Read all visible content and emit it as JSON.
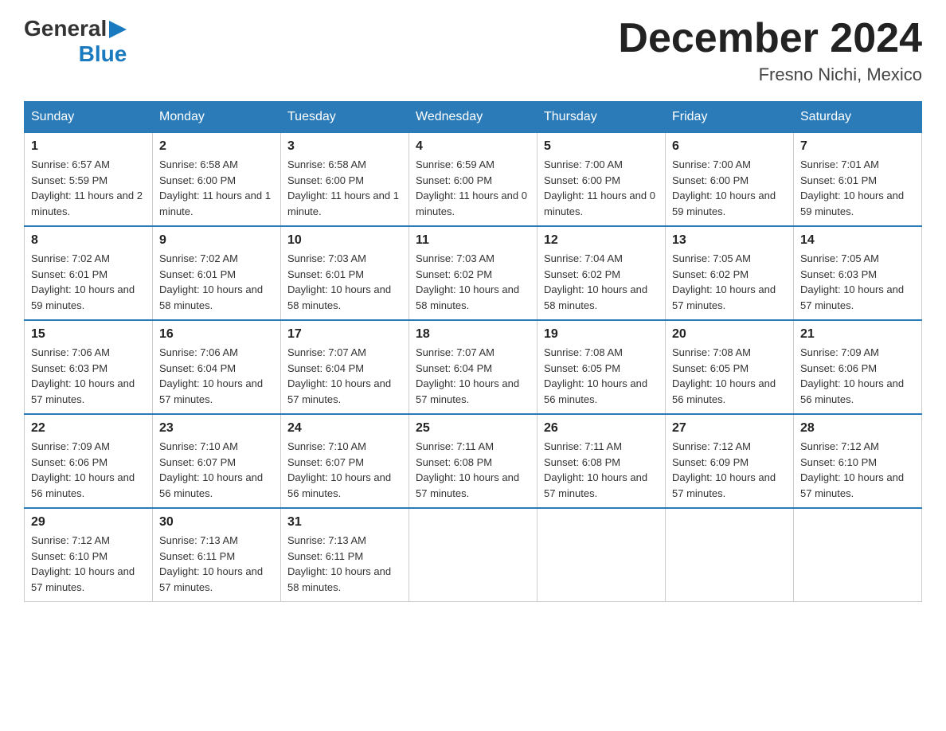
{
  "header": {
    "logo": {
      "general": "General",
      "arrow": "▶",
      "blue": "Blue"
    },
    "title": "December 2024",
    "location": "Fresno Nichi, Mexico"
  },
  "days_of_week": [
    "Sunday",
    "Monday",
    "Tuesday",
    "Wednesday",
    "Thursday",
    "Friday",
    "Saturday"
  ],
  "weeks": [
    [
      {
        "day": "1",
        "sunrise": "Sunrise: 6:57 AM",
        "sunset": "Sunset: 5:59 PM",
        "daylight": "Daylight: 11 hours and 2 minutes."
      },
      {
        "day": "2",
        "sunrise": "Sunrise: 6:58 AM",
        "sunset": "Sunset: 6:00 PM",
        "daylight": "Daylight: 11 hours and 1 minute."
      },
      {
        "day": "3",
        "sunrise": "Sunrise: 6:58 AM",
        "sunset": "Sunset: 6:00 PM",
        "daylight": "Daylight: 11 hours and 1 minute."
      },
      {
        "day": "4",
        "sunrise": "Sunrise: 6:59 AM",
        "sunset": "Sunset: 6:00 PM",
        "daylight": "Daylight: 11 hours and 0 minutes."
      },
      {
        "day": "5",
        "sunrise": "Sunrise: 7:00 AM",
        "sunset": "Sunset: 6:00 PM",
        "daylight": "Daylight: 11 hours and 0 minutes."
      },
      {
        "day": "6",
        "sunrise": "Sunrise: 7:00 AM",
        "sunset": "Sunset: 6:00 PM",
        "daylight": "Daylight: 10 hours and 59 minutes."
      },
      {
        "day": "7",
        "sunrise": "Sunrise: 7:01 AM",
        "sunset": "Sunset: 6:01 PM",
        "daylight": "Daylight: 10 hours and 59 minutes."
      }
    ],
    [
      {
        "day": "8",
        "sunrise": "Sunrise: 7:02 AM",
        "sunset": "Sunset: 6:01 PM",
        "daylight": "Daylight: 10 hours and 59 minutes."
      },
      {
        "day": "9",
        "sunrise": "Sunrise: 7:02 AM",
        "sunset": "Sunset: 6:01 PM",
        "daylight": "Daylight: 10 hours and 58 minutes."
      },
      {
        "day": "10",
        "sunrise": "Sunrise: 7:03 AM",
        "sunset": "Sunset: 6:01 PM",
        "daylight": "Daylight: 10 hours and 58 minutes."
      },
      {
        "day": "11",
        "sunrise": "Sunrise: 7:03 AM",
        "sunset": "Sunset: 6:02 PM",
        "daylight": "Daylight: 10 hours and 58 minutes."
      },
      {
        "day": "12",
        "sunrise": "Sunrise: 7:04 AM",
        "sunset": "Sunset: 6:02 PM",
        "daylight": "Daylight: 10 hours and 58 minutes."
      },
      {
        "day": "13",
        "sunrise": "Sunrise: 7:05 AM",
        "sunset": "Sunset: 6:02 PM",
        "daylight": "Daylight: 10 hours and 57 minutes."
      },
      {
        "day": "14",
        "sunrise": "Sunrise: 7:05 AM",
        "sunset": "Sunset: 6:03 PM",
        "daylight": "Daylight: 10 hours and 57 minutes."
      }
    ],
    [
      {
        "day": "15",
        "sunrise": "Sunrise: 7:06 AM",
        "sunset": "Sunset: 6:03 PM",
        "daylight": "Daylight: 10 hours and 57 minutes."
      },
      {
        "day": "16",
        "sunrise": "Sunrise: 7:06 AM",
        "sunset": "Sunset: 6:04 PM",
        "daylight": "Daylight: 10 hours and 57 minutes."
      },
      {
        "day": "17",
        "sunrise": "Sunrise: 7:07 AM",
        "sunset": "Sunset: 6:04 PM",
        "daylight": "Daylight: 10 hours and 57 minutes."
      },
      {
        "day": "18",
        "sunrise": "Sunrise: 7:07 AM",
        "sunset": "Sunset: 6:04 PM",
        "daylight": "Daylight: 10 hours and 57 minutes."
      },
      {
        "day": "19",
        "sunrise": "Sunrise: 7:08 AM",
        "sunset": "Sunset: 6:05 PM",
        "daylight": "Daylight: 10 hours and 56 minutes."
      },
      {
        "day": "20",
        "sunrise": "Sunrise: 7:08 AM",
        "sunset": "Sunset: 6:05 PM",
        "daylight": "Daylight: 10 hours and 56 minutes."
      },
      {
        "day": "21",
        "sunrise": "Sunrise: 7:09 AM",
        "sunset": "Sunset: 6:06 PM",
        "daylight": "Daylight: 10 hours and 56 minutes."
      }
    ],
    [
      {
        "day": "22",
        "sunrise": "Sunrise: 7:09 AM",
        "sunset": "Sunset: 6:06 PM",
        "daylight": "Daylight: 10 hours and 56 minutes."
      },
      {
        "day": "23",
        "sunrise": "Sunrise: 7:10 AM",
        "sunset": "Sunset: 6:07 PM",
        "daylight": "Daylight: 10 hours and 56 minutes."
      },
      {
        "day": "24",
        "sunrise": "Sunrise: 7:10 AM",
        "sunset": "Sunset: 6:07 PM",
        "daylight": "Daylight: 10 hours and 56 minutes."
      },
      {
        "day": "25",
        "sunrise": "Sunrise: 7:11 AM",
        "sunset": "Sunset: 6:08 PM",
        "daylight": "Daylight: 10 hours and 57 minutes."
      },
      {
        "day": "26",
        "sunrise": "Sunrise: 7:11 AM",
        "sunset": "Sunset: 6:08 PM",
        "daylight": "Daylight: 10 hours and 57 minutes."
      },
      {
        "day": "27",
        "sunrise": "Sunrise: 7:12 AM",
        "sunset": "Sunset: 6:09 PM",
        "daylight": "Daylight: 10 hours and 57 minutes."
      },
      {
        "day": "28",
        "sunrise": "Sunrise: 7:12 AM",
        "sunset": "Sunset: 6:10 PM",
        "daylight": "Daylight: 10 hours and 57 minutes."
      }
    ],
    [
      {
        "day": "29",
        "sunrise": "Sunrise: 7:12 AM",
        "sunset": "Sunset: 6:10 PM",
        "daylight": "Daylight: 10 hours and 57 minutes."
      },
      {
        "day": "30",
        "sunrise": "Sunrise: 7:13 AM",
        "sunset": "Sunset: 6:11 PM",
        "daylight": "Daylight: 10 hours and 57 minutes."
      },
      {
        "day": "31",
        "sunrise": "Sunrise: 7:13 AM",
        "sunset": "Sunset: 6:11 PM",
        "daylight": "Daylight: 10 hours and 58 minutes."
      },
      {
        "day": "",
        "sunrise": "",
        "sunset": "",
        "daylight": ""
      },
      {
        "day": "",
        "sunrise": "",
        "sunset": "",
        "daylight": ""
      },
      {
        "day": "",
        "sunrise": "",
        "sunset": "",
        "daylight": ""
      },
      {
        "day": "",
        "sunrise": "",
        "sunset": "",
        "daylight": ""
      }
    ]
  ]
}
